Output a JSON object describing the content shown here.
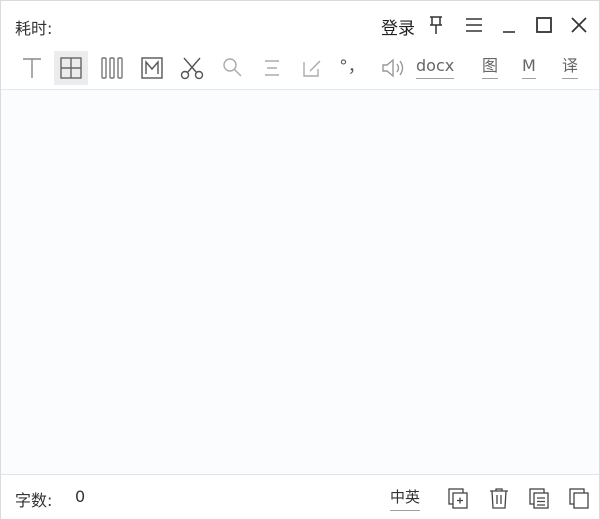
{
  "titlebar": {
    "elapsed_label": "耗时:",
    "login_label": "登录",
    "icons": [
      "pin-icon",
      "menu-icon",
      "minimize-icon",
      "maximize-icon",
      "close-icon"
    ]
  },
  "toolbar": {
    "icons": [
      "text-cursor-icon",
      "table-grid-icon",
      "columns-icon",
      "markdown-box-icon",
      "scissors-icon",
      "search-icon",
      "align-icon",
      "edit-box-icon",
      "punctuation-icon",
      "speaker-icon"
    ],
    "punctuation_label": "°，",
    "docx_label": "docx",
    "image_label": "图",
    "markdown_label": "M",
    "translate_label": "译",
    "active_tool": "table-grid-icon"
  },
  "statusbar": {
    "word_count_label": "字数:",
    "word_count_value": "0",
    "language_label": "中英",
    "icons": [
      "add-page-icon",
      "trash-icon",
      "copy-list-icon",
      "duplicate-icon"
    ]
  }
}
